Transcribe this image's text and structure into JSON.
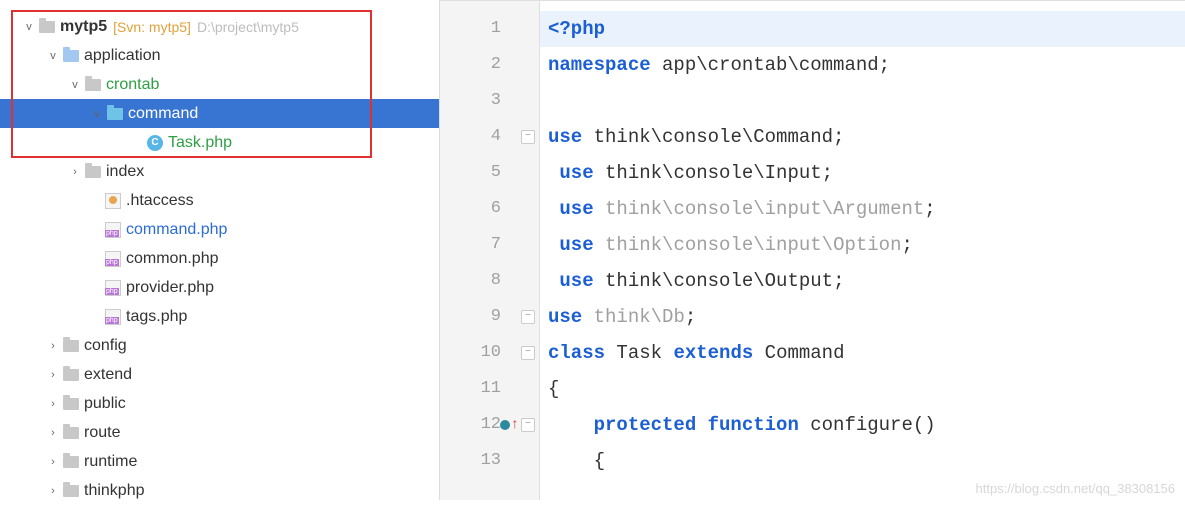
{
  "tree": {
    "root": {
      "name": "mytp5",
      "vcs": "[Svn: mytp5]",
      "path": "D:\\project\\mytp5"
    },
    "items": [
      {
        "name": "application",
        "type": "folder-blue",
        "indent": 46,
        "chev": "v",
        "color": ""
      },
      {
        "name": "crontab",
        "type": "folder-gray",
        "indent": 68,
        "chev": "v",
        "color": "green"
      },
      {
        "name": "command",
        "type": "folder-white",
        "indent": 90,
        "chev": "v",
        "selected": true
      },
      {
        "name": "Task.php",
        "type": "file-c",
        "indent": 130,
        "chev": "",
        "color": "green"
      },
      {
        "name": "index",
        "type": "folder-gray",
        "indent": 68,
        "chev": ">",
        "color": ""
      },
      {
        "name": ".htaccess",
        "type": "file-ht",
        "indent": 88,
        "chev": "",
        "color": ""
      },
      {
        "name": "command.php",
        "type": "file-php",
        "indent": 88,
        "chev": "",
        "color": "blue"
      },
      {
        "name": "common.php",
        "type": "file-php",
        "indent": 88,
        "chev": "",
        "color": ""
      },
      {
        "name": "provider.php",
        "type": "file-php",
        "indent": 88,
        "chev": "",
        "color": ""
      },
      {
        "name": "tags.php",
        "type": "file-php",
        "indent": 88,
        "chev": "",
        "color": ""
      },
      {
        "name": "config",
        "type": "folder-gray",
        "indent": 46,
        "chev": ">",
        "color": ""
      },
      {
        "name": "extend",
        "type": "folder-gray",
        "indent": 46,
        "chev": ">",
        "color": ""
      },
      {
        "name": "public",
        "type": "folder-gray",
        "indent": 46,
        "chev": ">",
        "color": ""
      },
      {
        "name": "route",
        "type": "folder-gray",
        "indent": 46,
        "chev": ">",
        "color": ""
      },
      {
        "name": "runtime",
        "type": "folder-gray",
        "indent": 46,
        "chev": ">",
        "color": ""
      },
      {
        "name": "thinkphp",
        "type": "folder-gray",
        "indent": 46,
        "chev": ">",
        "color": ""
      }
    ]
  },
  "code": {
    "lines": [
      {
        "n": 1,
        "hl": true,
        "tokens": [
          [
            "kw",
            "<?php"
          ]
        ]
      },
      {
        "n": 2,
        "tokens": [
          [
            "kw",
            "namespace"
          ],
          [
            "",
            " app\\crontab\\command;"
          ]
        ]
      },
      {
        "n": 3,
        "tokens": []
      },
      {
        "n": 4,
        "fold": true,
        "tokens": [
          [
            "kw",
            "use"
          ],
          [
            "",
            " think\\console\\Command;"
          ]
        ]
      },
      {
        "n": 5,
        "tokens": [
          [
            "",
            " "
          ],
          [
            "kw",
            "use"
          ],
          [
            "",
            " think\\console\\Input;"
          ]
        ]
      },
      {
        "n": 6,
        "tokens": [
          [
            "",
            " "
          ],
          [
            "kw",
            "use"
          ],
          [
            "",
            " "
          ],
          [
            "gray",
            "think\\console\\input\\Argument"
          ],
          [
            "",
            ";"
          ]
        ]
      },
      {
        "n": 7,
        "tokens": [
          [
            "",
            " "
          ],
          [
            "kw",
            "use"
          ],
          [
            "",
            " "
          ],
          [
            "gray",
            "think\\console\\input\\Option"
          ],
          [
            "",
            ";"
          ]
        ]
      },
      {
        "n": 8,
        "tokens": [
          [
            "",
            " "
          ],
          [
            "kw",
            "use"
          ],
          [
            "",
            " think\\console\\Output;"
          ]
        ]
      },
      {
        "n": 9,
        "fold": true,
        "tokens": [
          [
            "kw",
            "use"
          ],
          [
            "",
            " "
          ],
          [
            "gray",
            "think\\Db"
          ],
          [
            "",
            ";"
          ]
        ]
      },
      {
        "n": 10,
        "fold": true,
        "tokens": [
          [
            "kw",
            "class"
          ],
          [
            "",
            " Task "
          ],
          [
            "kw",
            "extends"
          ],
          [
            "",
            " Command"
          ]
        ]
      },
      {
        "n": 11,
        "tokens": [
          [
            "",
            "{"
          ]
        ]
      },
      {
        "n": 12,
        "fold": true,
        "mark": true,
        "tokens": [
          [
            "",
            "    "
          ],
          [
            "kw2",
            "protected function"
          ],
          [
            "",
            " configure()"
          ]
        ]
      },
      {
        "n": 13,
        "tokens": [
          [
            "",
            "    {"
          ]
        ]
      }
    ]
  },
  "watermark": "https://blog.csdn.net/qq_38308156"
}
